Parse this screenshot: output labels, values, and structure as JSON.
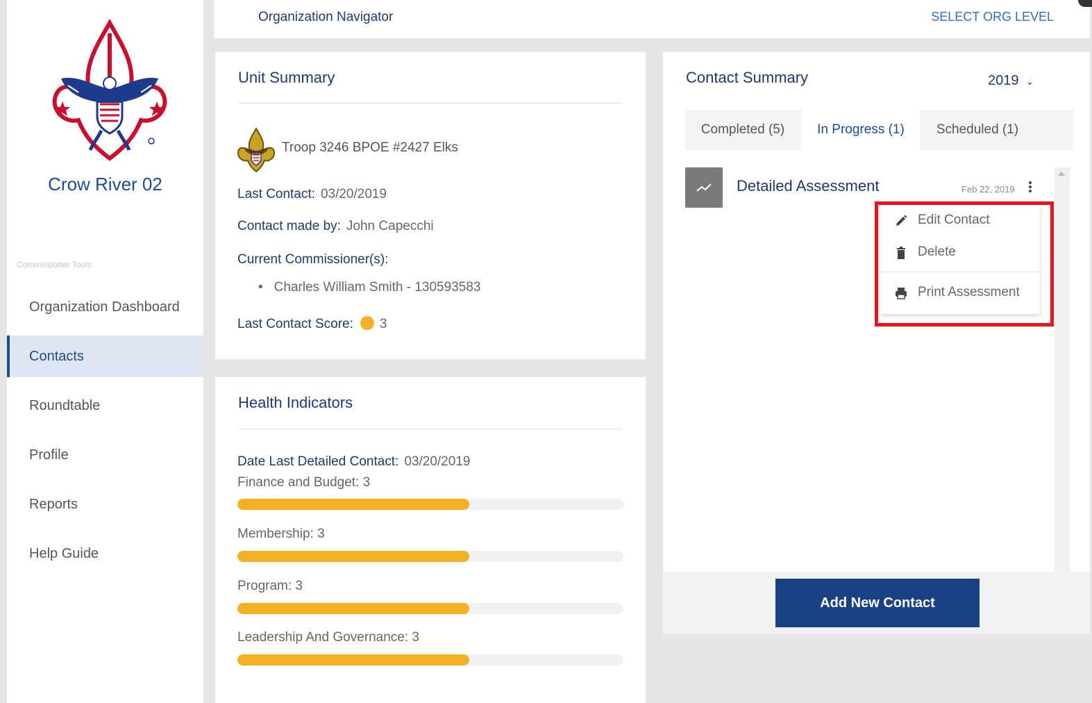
{
  "sidebar": {
    "council_name": "Crow River 02",
    "tools_label": "Commissioner Tools",
    "items": [
      {
        "label": "Organization Dashboard"
      },
      {
        "label": "Contacts"
      },
      {
        "label": "Roundtable"
      },
      {
        "label": "Profile"
      },
      {
        "label": "Reports"
      },
      {
        "label": "Help Guide"
      }
    ],
    "active_item": "Contacts"
  },
  "topbar": {
    "title": "Organization Navigator",
    "select_org_level": "SELECT ORG LEVEL"
  },
  "unit_summary": {
    "title": "Unit Summary",
    "troop_name": "Troop 3246 BPOE #2427 Elks",
    "last_contact_label": "Last Contact:",
    "last_contact_value": "03/20/2019",
    "contact_made_by_label": "Contact made by:",
    "contact_made_by_value": "John Capecchi",
    "current_commissioners_label": "Current Commissioner(s):",
    "commissioners": [
      "Charles William Smith - 130593583"
    ],
    "last_contact_score_label": "Last Contact Score:",
    "last_contact_score_value": "3"
  },
  "health_indicators": {
    "title": "Health Indicators",
    "date_last_detailed_label": "Date Last Detailed Contact:",
    "date_last_detailed_value": "03/20/2019",
    "bars": [
      {
        "label": "Finance and Budget: 3",
        "fraction": 0.6
      },
      {
        "label": "Membership: 3",
        "fraction": 0.6
      },
      {
        "label": "Program: 3",
        "fraction": 0.6
      },
      {
        "label": "Leadership And Governance: 3",
        "fraction": 0.6
      }
    ]
  },
  "contact_summary": {
    "title": "Contact Summary",
    "year": "2019",
    "tabs": [
      {
        "label": "Completed (5)"
      },
      {
        "label": "In Progress (1)"
      },
      {
        "label": "Scheduled (1)"
      }
    ],
    "active_tab": "In Progress (1)",
    "entry": {
      "title": "Detailed Assessment",
      "date": "Feb 22, 2019"
    },
    "add_button": "Add New Contact"
  },
  "context_menu": {
    "items": [
      {
        "label": "Edit Contact",
        "icon": "pencil-icon"
      },
      {
        "label": "Delete",
        "icon": "trash-icon"
      },
      {
        "label": "Print Assessment",
        "icon": "printer-icon"
      }
    ]
  },
  "colors": {
    "primary_blue": "#1a4183",
    "link_blue": "#2d6fc4",
    "score_yellow": "#f3b225",
    "highlight_red": "#e8131d"
  }
}
